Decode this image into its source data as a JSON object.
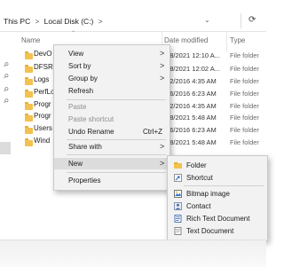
{
  "address": {
    "segments": [
      "This PC",
      "Local Disk (C:)"
    ],
    "separator": ">"
  },
  "columns": {
    "name": "Name",
    "date": "Date modified",
    "type": "Type"
  },
  "files": [
    {
      "name": "DevO",
      "date": "/18/2021 12:10 A...",
      "type": "File folder"
    },
    {
      "name": "DFSR",
      "date": "/18/2021 12:02 A...",
      "type": "File folder"
    },
    {
      "name": "Logs",
      "date": "/12/2016 4:35 AM",
      "type": "File folder"
    },
    {
      "name": "PerfLo",
      "date": "/16/2016 6:23 AM",
      "type": "File folder"
    },
    {
      "name": "Progr",
      "date": "/12/2016 4:35 AM",
      "type": "File folder"
    },
    {
      "name": "Progr",
      "date": "/28/2021 5:48 AM",
      "type": "File folder"
    },
    {
      "name": "Users",
      "date": "/16/2016 6:23 AM",
      "type": "File folder"
    },
    {
      "name": "Wind",
      "date": "/28/2021 5:48 AM",
      "type": "File folder"
    }
  ],
  "context_menu": {
    "view": "View",
    "sort_by": "Sort by",
    "group_by": "Group by",
    "refresh": "Refresh",
    "paste": "Paste",
    "paste_shortcut": "Paste shortcut",
    "undo_rename": "Undo Rename",
    "undo_shortcut": "Ctrl+Z",
    "share_with": "Share with",
    "new": "New",
    "properties": "Properties"
  },
  "new_submenu": {
    "folder": "Folder",
    "shortcut": "Shortcut",
    "bitmap": "Bitmap image",
    "contact": "Contact",
    "rtf": "Rich Text Document",
    "text": "Text Document"
  },
  "icons": {
    "submenu_arrow": ">",
    "dropdown": "v",
    "refresh": "⟳",
    "pin": "📌"
  },
  "colors": {
    "folder": "#f2c14e",
    "menu_bg": "#f2f2f2",
    "highlight": "#dcdcdc",
    "disabled_text": "#8d8d8d"
  }
}
